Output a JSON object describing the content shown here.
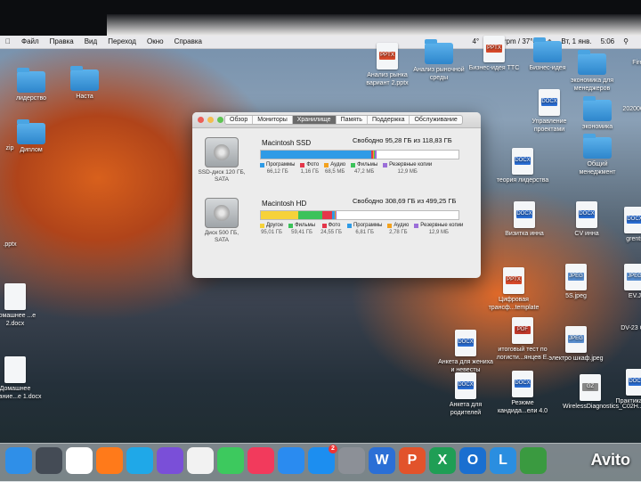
{
  "menubar": {
    "items": [
      "Файл",
      "Правка",
      "Вид",
      "Переход",
      "Окно",
      "Справка"
    ],
    "status": [
      "4°",
      "1999rpm / 37°C",
      "Вт, 1 янв.",
      "5:06"
    ]
  },
  "desktop_left": [
    {
      "label": "лидерство",
      "kind": "folder"
    },
    {
      "label": "Наста",
      "kind": "folder"
    },
    {
      "label": "Диплом",
      "kind": "folder"
    },
    {
      "label": "zip",
      "kind": "text"
    },
    {
      "label": ".pptx",
      "kind": "text"
    },
    {
      "label": "Домашнее ...е 2.docx",
      "kind": "doc"
    },
    {
      "label": "Домашнее задание...е 1.docx",
      "kind": "doc"
    }
  ],
  "desktop_right": [
    {
      "label": "Анализ рынка вариант 2.pptx",
      "kind": "pptx"
    },
    {
      "label": "Анализ рыночной среды",
      "kind": "folder"
    },
    {
      "label": "Бизнес-идея ТТС",
      "kind": "pptx"
    },
    {
      "label": "Бизнес-идея",
      "kind": "folder"
    },
    {
      "label": "экономика для менеджеров",
      "kind": "folder"
    },
    {
      "label": "Firefox",
      "kind": "text"
    },
    {
      "label": "Управление проектами",
      "kind": "doc"
    },
    {
      "label": "экономика",
      "kind": "folder"
    },
    {
      "label": "20200604",
      "kind": "text"
    },
    {
      "label": "Общий менеджмент",
      "kind": "folder"
    },
    {
      "label": "теория лидерства",
      "kind": "doc"
    },
    {
      "label": "Визитка инна",
      "kind": "doc"
    },
    {
      "label": "CV инна",
      "kind": "doc"
    },
    {
      "label": "grents",
      "kind": "doc"
    },
    {
      "label": "Цифровая трансф...template",
      "kind": "pptx"
    },
    {
      "label": "5S.jpeg",
      "kind": "jpeg"
    },
    {
      "label": "EV.J",
      "kind": "jpeg"
    },
    {
      "label": "Анкета для жениха и невесты",
      "kind": "doc"
    },
    {
      "label": "итоговый тест по логисти...янцев Е.",
      "kind": "pdf"
    },
    {
      "label": "электро шкаф.jpeg",
      "kind": "jpeg"
    },
    {
      "label": "DV-23 GA",
      "kind": "text"
    },
    {
      "label": "Анкета для родителей",
      "kind": "doc"
    },
    {
      "label": "Резюме кандида...ели 4.0",
      "kind": "doc"
    },
    {
      "label": "WirelessDiagnostics_C02H...4.tar.gz",
      "kind": "gz"
    },
    {
      "label": "Практика.docx",
      "kind": "doc"
    }
  ],
  "window": {
    "tabs": [
      "Обзор",
      "Мониторы",
      "Хранилище",
      "Память",
      "Поддержка",
      "Обслуживание"
    ],
    "active_tab": "Хранилище",
    "drives": [
      {
        "name": "Macintosh SSD",
        "free": "Свободно 95,28 ГБ из 118,83 ГБ",
        "caption": "SSD-диск 120 ГБ, SATA",
        "segments": [
          {
            "label": "Программы",
            "size": "66,12 ГБ",
            "color": "#2e9be6",
            "value": 66.12
          },
          {
            "label": "Фото",
            "size": "1,16 ГБ",
            "color": "#e4364a",
            "value": 1.16
          },
          {
            "label": "Аудио",
            "size": "68,5 МБ",
            "color": "#f3a21e",
            "value": 0.07
          },
          {
            "label": "Фильмы",
            "size": "47,2 МБ",
            "color": "#3cc25a",
            "value": 0.05
          },
          {
            "label": "Резервные копии",
            "size": "12,9 МБ",
            "color": "#9b6ed8",
            "value": 0.01
          }
        ],
        "total": 118.83
      },
      {
        "name": "Macintosh HD",
        "free": "Свободно 308,69 ГБ из 499,25 ГБ",
        "caption": "Диск 500 ГБ, SATA",
        "segments": [
          {
            "label": "Другое",
            "size": "95,01 ГБ",
            "color": "#f6d23a",
            "value": 95.01
          },
          {
            "label": "Фильмы",
            "size": "59,41 ГБ",
            "color": "#3cc25a",
            "value": 59.41
          },
          {
            "label": "Фото",
            "size": "24,55 ГБ",
            "color": "#e4364a",
            "value": 24.55
          },
          {
            "label": "Программы",
            "size": "6,81 ГБ",
            "color": "#2e9be6",
            "value": 6.81
          },
          {
            "label": "Аудио",
            "size": "2,78 ГБ",
            "color": "#f3a21e",
            "value": 2.78
          },
          {
            "label": "Резервные копии",
            "size": "12,9 МБ",
            "color": "#9b6ed8",
            "value": 0.01
          }
        ],
        "total": 499.25
      }
    ]
  },
  "dock": [
    {
      "icon": "finder-icon",
      "color": "#2f8fe8"
    },
    {
      "icon": "launchpad-icon",
      "color": "#444b55"
    },
    {
      "icon": "chrome-icon",
      "color": "#ffffff"
    },
    {
      "icon": "firefox-icon",
      "color": "#ff7a1a"
    },
    {
      "icon": "skype-icon",
      "color": "#1fa8e8"
    },
    {
      "icon": "viber-icon",
      "color": "#7a4fd8"
    },
    {
      "icon": "photos-icon",
      "color": "#f2f2f2"
    },
    {
      "icon": "messages-icon",
      "color": "#3dc95e"
    },
    {
      "icon": "music-icon",
      "color": "#f23a5c"
    },
    {
      "icon": "appstore-alt-icon",
      "color": "#2a8bf0"
    },
    {
      "icon": "appstore-icon",
      "color": "#1c8ef0",
      "badge": "2"
    },
    {
      "icon": "system-preferences-icon",
      "color": "#8c9097"
    },
    {
      "icon": "word-icon",
      "color": "#2b6fd6",
      "letter": "W"
    },
    {
      "icon": "powerpoint-icon",
      "color": "#e2532b",
      "letter": "P"
    },
    {
      "icon": "excel-icon",
      "color": "#1f9e55",
      "letter": "X"
    },
    {
      "icon": "outlook-icon",
      "color": "#1a6fd0",
      "letter": "O"
    },
    {
      "icon": "lync-icon",
      "color": "#2a8ee0",
      "letter": "L"
    },
    {
      "icon": "network-icon",
      "color": "#3a9a40"
    }
  ],
  "watermark": "Avito"
}
